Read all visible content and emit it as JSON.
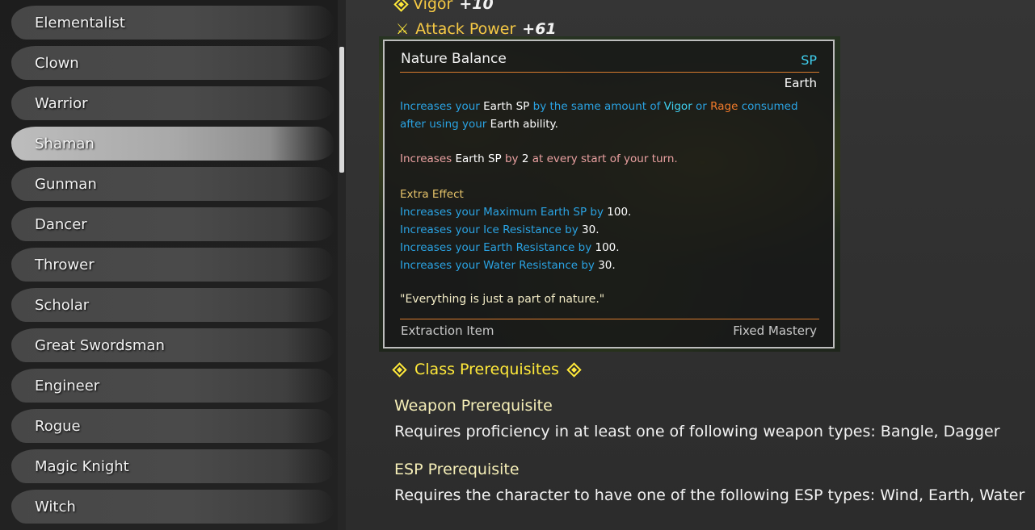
{
  "sidebar": {
    "selected_index": 3,
    "items": [
      {
        "label": "Elementalist"
      },
      {
        "label": "Clown"
      },
      {
        "label": "Warrior"
      },
      {
        "label": "Shaman"
      },
      {
        "label": "Gunman"
      },
      {
        "label": "Dancer"
      },
      {
        "label": "Thrower"
      },
      {
        "label": "Scholar"
      },
      {
        "label": "Great Swordsman"
      },
      {
        "label": "Engineer"
      },
      {
        "label": "Rogue"
      },
      {
        "label": "Magic Knight"
      },
      {
        "label": "Witch"
      }
    ]
  },
  "stats": {
    "vigor": {
      "label": "Vigor",
      "value": "+10"
    },
    "attack": {
      "label": "Attack Power",
      "value": "+61"
    }
  },
  "tooltip": {
    "title": "Nature Balance",
    "sp_label": "SP",
    "sp_type": "Earth",
    "desc1": {
      "a": "Increases your",
      "b": "Earth SP",
      "c": "by the same amount of",
      "d": "Vigor",
      "e": "or",
      "f": "Rage",
      "g": "consumed",
      "h": "after using your",
      "i": "Earth",
      "j": "ability",
      "k": "."
    },
    "desc2": {
      "a": "Increases",
      "b": "Earth SP",
      "c": "by",
      "d": "2",
      "e": "at every start of your turn."
    },
    "extra_title": "Extra Effect",
    "extra_lines": [
      {
        "text": "Increases your Maximum Earth SP by",
        "value": "100"
      },
      {
        "text": "Increases your Ice Resistance by",
        "value": "30"
      },
      {
        "text": "Increases your Earth Resistance by",
        "value": "100"
      },
      {
        "text": "Increases your Water Resistance by",
        "value": "30"
      }
    ],
    "quote": "\"Everything is just a part of nature.\"",
    "footer_left": "Extraction Item",
    "footer_right": "Fixed Mastery"
  },
  "prerequisites": {
    "header": "Class Prerequisites",
    "weapon_title": "Weapon Prerequisite",
    "weapon_text": "Requires proficiency in at least one of following weapon types: Bangle, Dagger",
    "esp_title": "ESP Prerequisite",
    "esp_text": "Requires the character to have one of the following ESP types: Wind, Earth, Water"
  },
  "colors": {
    "accent_gold": "#ffe93a",
    "tooltip_border": "#bdbdbd",
    "divider_orange": "#d97b2e",
    "text_blue": "#2aa3e3",
    "text_cyan": "#3fd0f0"
  }
}
